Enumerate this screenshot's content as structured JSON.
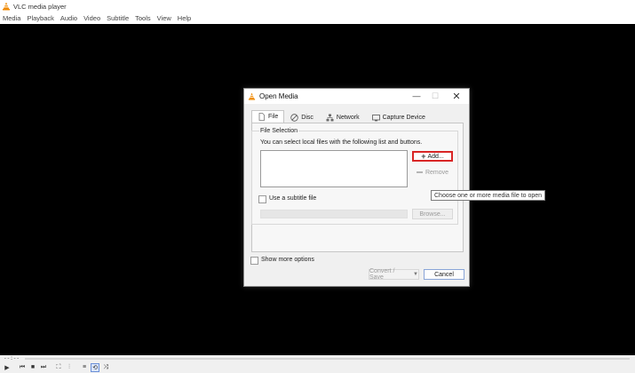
{
  "window": {
    "title": "VLC media player",
    "icon": "vlc-cone-icon"
  },
  "menu": [
    "Media",
    "Playback",
    "Audio",
    "Video",
    "Subtitle",
    "Tools",
    "View",
    "Help"
  ],
  "seek": {
    "time": "--:--"
  },
  "controls": [
    {
      "name": "play-button",
      "icon": "play-icon",
      "glyph": "▶"
    },
    {
      "name": "previous-button",
      "icon": "previous-icon",
      "glyph": "⏮"
    },
    {
      "name": "stop-button",
      "icon": "stop-icon",
      "glyph": "■"
    },
    {
      "name": "next-button",
      "icon": "next-icon",
      "glyph": "⏭"
    },
    {
      "name": "fullscreen-button",
      "icon": "fullscreen-icon",
      "glyph": "⛶"
    },
    {
      "name": "extended-settings-button",
      "icon": "equalizer-icon",
      "glyph": "⫶"
    },
    {
      "name": "playlist-button",
      "icon": "playlist-icon",
      "glyph": "≡"
    },
    {
      "name": "loop-button",
      "icon": "loop-icon",
      "glyph": "⟲"
    },
    {
      "name": "shuffle-button",
      "icon": "shuffle-icon",
      "glyph": "⤨"
    }
  ],
  "dialog": {
    "title": "Open Media",
    "tabs": [
      {
        "label": "File",
        "icon": "file-icon",
        "active": true
      },
      {
        "label": "Disc",
        "icon": "disc-icon",
        "active": false
      },
      {
        "label": "Network",
        "icon": "network-icon",
        "active": false
      },
      {
        "label": "Capture Device",
        "icon": "capture-device-icon",
        "active": false
      }
    ],
    "file_selection": {
      "label": "File Selection",
      "hint": "You can select local files with the following list and buttons.",
      "add_label": "Add...",
      "remove_label": "Remove"
    },
    "subtitle": {
      "label": "Use a subtitle file",
      "checked": false,
      "browse_label": "Browse..."
    },
    "show_more_label": "Show more options",
    "show_more_checked": false,
    "convert_label": "Convert / Save",
    "cancel_label": "Cancel"
  },
  "tooltip": "Choose one or more media file to open",
  "colors": {
    "highlight_border": "#d92626",
    "vlc_orange": "#f08a00"
  }
}
